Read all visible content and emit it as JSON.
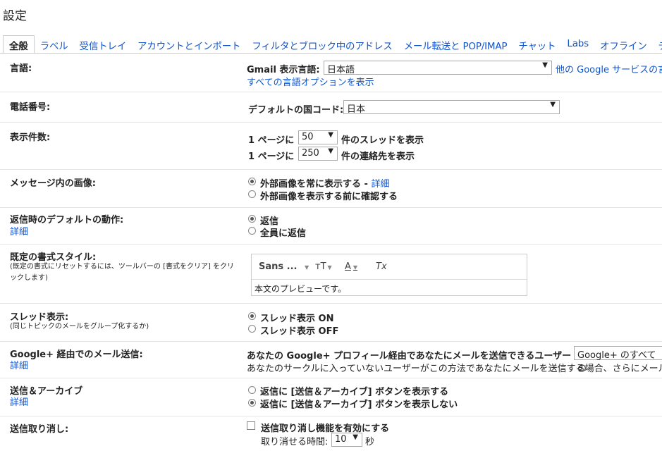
{
  "page": {
    "title": "設定"
  },
  "tabs": [
    "全般",
    "ラベル",
    "受信トレイ",
    "アカウントとインポート",
    "フィルタとブロック中のアドレス",
    "メール転送と POP/IMAP",
    "チャット",
    "Labs",
    "オフライン",
    "テーマ"
  ],
  "language": {
    "label": "言語:",
    "display_label": "Gmail 表示言語:",
    "display_value": "日本語",
    "other_services": "他の Google サービスの言",
    "all_options_link": "すべての言語オプションを表示"
  },
  "phone": {
    "label": "電話番号:",
    "country_label": "デフォルトの国コード:",
    "country_value": "日本"
  },
  "page_size": {
    "label": "表示件数:",
    "prefix1": "1 ページに",
    "threads_value": "50",
    "suffix1": "件のスレッドを表示",
    "prefix2": "1 ページに",
    "contacts_value": "250",
    "suffix2": "件の連絡先を表示"
  },
  "images": {
    "label": "メッセージ内の画像:",
    "opt1": "外部画像を常に表示する",
    "opt1_link": "詳細",
    "opt2": "外部画像を表示する前に確認する"
  },
  "reply": {
    "label": "返信時のデフォルトの動作:",
    "link": "詳細",
    "opt1": "返信",
    "opt2": "全員に返信"
  },
  "text_style": {
    "label": "既定の書式スタイル:",
    "sub": "(既定の書式にリセットするには、ツールバーの [書式をクリア] をクリックします)",
    "font": "Sans ...",
    "size_icon": "тT",
    "color_icon": "A",
    "clear_icon": "Tx",
    "preview": "本文のプレビューです。"
  },
  "conversation": {
    "label": "スレッド表示:",
    "sub": "(同じトピックのメールをグループ化するか)",
    "opt1": "スレッド表示 ON",
    "opt2": "スレッド表示 OFF"
  },
  "gplus": {
    "label": "Google+ 経由でのメール送信:",
    "link": "詳細",
    "text1": "あなたの Google+ プロフィール経由であなたにメールを送信できるユーザー",
    "select_value": "Google+ のすべての",
    "text2": "あなたのサークルに入っていないユーザーがこの方法であなたにメールを送信する場合、さらにメール"
  },
  "send_archive": {
    "label": "送信＆アーカイブ",
    "link": "詳細",
    "opt1": "返信に [送信＆アーカイブ] ボタンを表示する",
    "opt2": "返信に [送信＆アーカイブ] ボタンを表示しない"
  },
  "undo": {
    "label": "送信取り消し:",
    "check_label": "送信取り消し機能を有効にする",
    "period_label": "取り消せる時間:",
    "period_value": "10",
    "period_unit": "秒"
  }
}
